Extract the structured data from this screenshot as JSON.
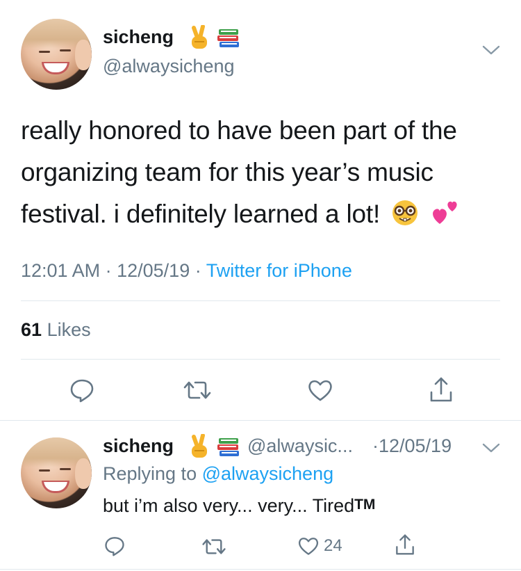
{
  "main_tweet": {
    "display_name": "sicheng",
    "name_emojis": [
      "victory-hand-icon",
      "books-icon"
    ],
    "handle": "@alwaysicheng",
    "text_lines": [
      "really honored to have been part of the",
      "organizing team for this year’s music",
      "festival. i definitely learned a lot!"
    ],
    "text_emojis": [
      "nerd-face-icon",
      "two-hearts-icon"
    ],
    "time": "12:01 AM",
    "date": "12/05/19",
    "separator": "·",
    "source": "Twitter for iPhone",
    "likes_count": "61",
    "likes_label": "Likes"
  },
  "reply_tweet": {
    "display_name": "sicheng",
    "handle_truncated": "@alwaysic...",
    "date": "·12/05/19",
    "replying_label": "Replying to",
    "replying_handle": "@alwaysicheng",
    "text": "but i’m also very... very... Tired",
    "trademark": "TM",
    "like_count": "24"
  },
  "colors": {
    "text": "#14171a",
    "secondary": "#657786",
    "link": "#1da1f2",
    "divider": "#e1e8ed"
  }
}
